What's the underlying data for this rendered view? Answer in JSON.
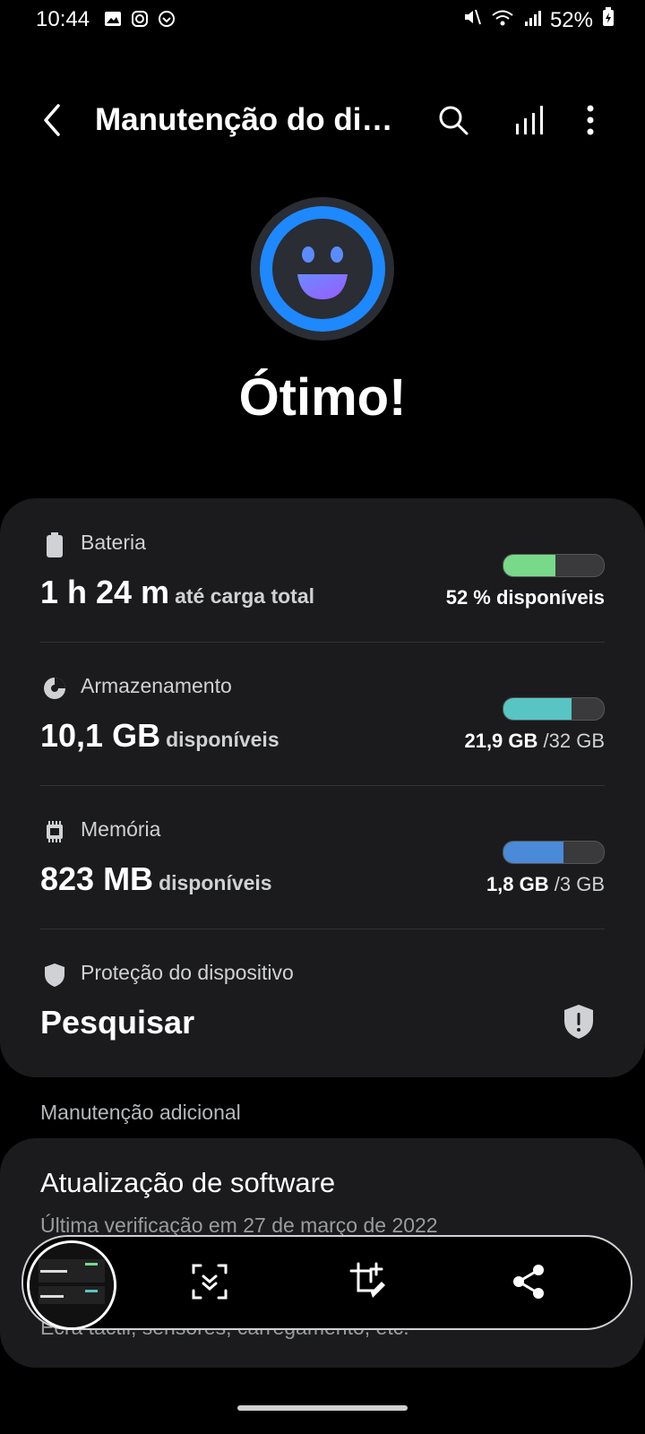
{
  "status_bar": {
    "time": "10:44",
    "battery": "52%"
  },
  "appbar": {
    "title": "Manutenção do di…"
  },
  "hero": {
    "title": "Ótimo!"
  },
  "card": {
    "battery": {
      "label": "Bateria",
      "value": "1 h 24 m",
      "value_sub": "até carga total",
      "right_text": "52 % disponíveis",
      "level": 0.52,
      "color": "#79d98a"
    },
    "storage": {
      "label": "Armazenamento",
      "value": "10,1 GB",
      "value_sub": "disponíveis",
      "right_bold": "21,9 GB",
      "right_rest": " /32 GB",
      "level": 0.68,
      "color": "#59c4c4"
    },
    "memory": {
      "label": "Memória",
      "value": "823 MB",
      "value_sub": "disponíveis",
      "right_bold": "1,8 GB",
      "right_rest": " /3 GB",
      "level": 0.6,
      "color": "#4a8ad8"
    },
    "protection": {
      "label": "Proteção do dispositivo",
      "value": "Pesquisar"
    }
  },
  "section": {
    "title": "Manutenção adicional"
  },
  "card2": {
    "title": "Atualização de software",
    "subtitle": "Última verificação em 27 de março de 2022",
    "subtitle2": "Ecrã táctil, sensores, carregamento, etc."
  },
  "colors": {
    "accent": "#1e88ff",
    "card_bg": "#1b1b1d"
  }
}
